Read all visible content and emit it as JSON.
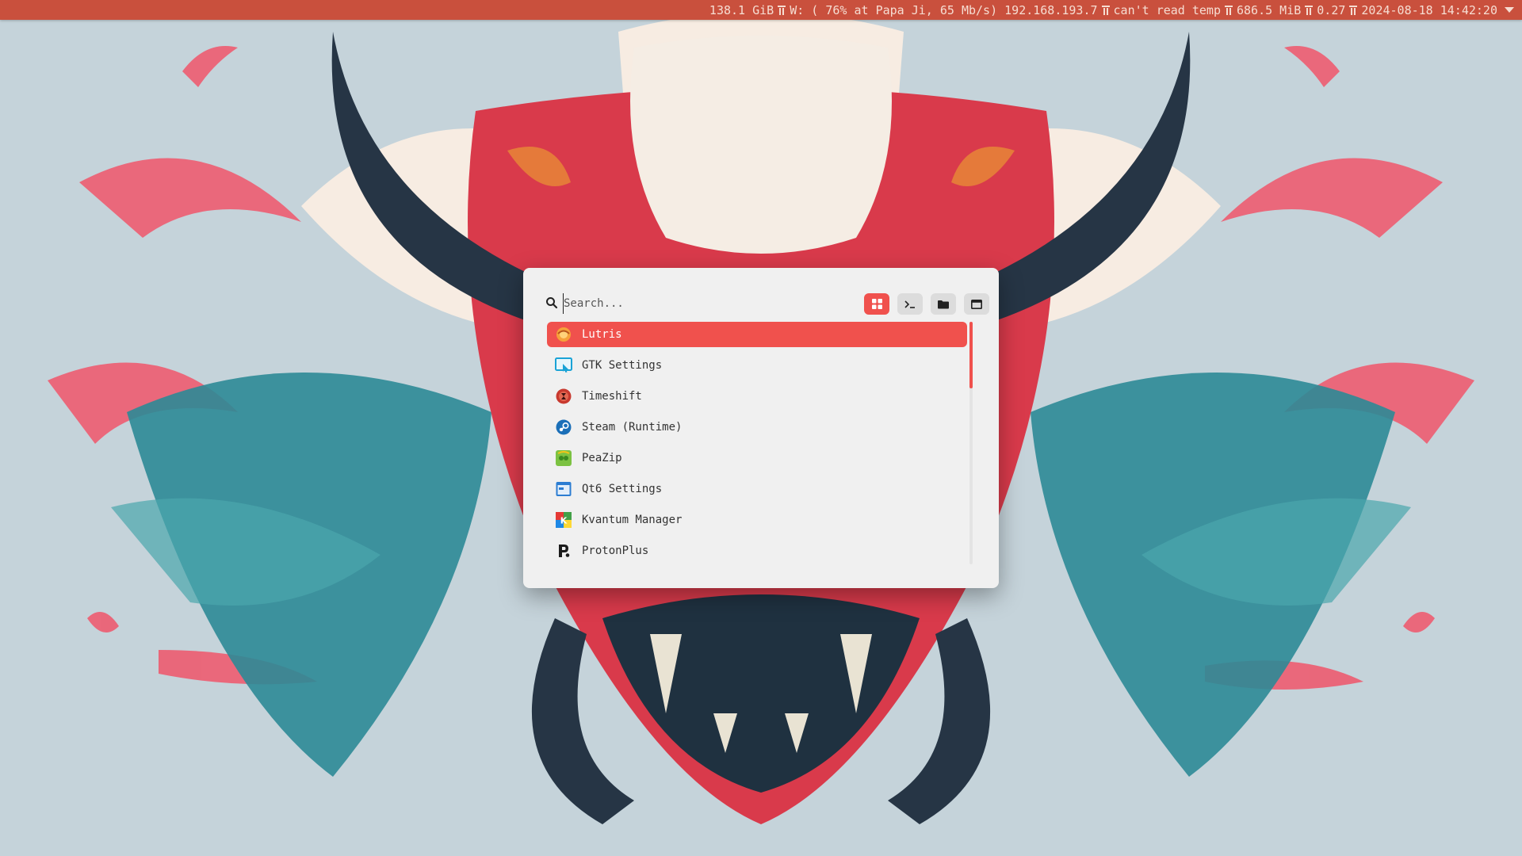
{
  "statusbar": {
    "disk": "138.1 GiB",
    "wifi": "W: ( 76% at Papa Ji, 65 Mb/s) 192.168.193.7",
    "temp": "can't read temp",
    "memory": "686.5 MiB",
    "load": "0.27",
    "datetime": "2024-08-18 14:42:20",
    "separator_icon": "torii-icon",
    "menu_icon": "chevron-down-icon"
  },
  "launcher": {
    "search": {
      "placeholder": "Search...",
      "value": ""
    },
    "modes": [
      {
        "name": "apps",
        "icon": "grid-icon",
        "active": true
      },
      {
        "name": "terminal",
        "icon": "terminal-icon",
        "active": false
      },
      {
        "name": "files",
        "icon": "folder-icon",
        "active": false
      },
      {
        "name": "windows",
        "icon": "window-icon",
        "active": false
      }
    ],
    "results": [
      {
        "label": "Lutris",
        "icon": "lutris-icon",
        "selected": true
      },
      {
        "label": "GTK Settings",
        "icon": "gtk-settings-icon",
        "selected": false
      },
      {
        "label": "Timeshift",
        "icon": "timeshift-icon",
        "selected": false
      },
      {
        "label": "Steam (Runtime)",
        "icon": "steam-icon",
        "selected": false
      },
      {
        "label": "PeaZip",
        "icon": "peazip-icon",
        "selected": false
      },
      {
        "label": "Qt6 Settings",
        "icon": "qt6-settings-icon",
        "selected": false
      },
      {
        "label": "Kvantum Manager",
        "icon": "kvantum-icon",
        "selected": false
      },
      {
        "label": "ProtonPlus",
        "icon": "protonplus-icon",
        "selected": false
      }
    ]
  },
  "colors": {
    "statusbar_bg": "#c9503d",
    "accent": "#f0514d",
    "launcher_bg": "#f0f0f0",
    "wallpaper_bg": "#c5d3da"
  }
}
